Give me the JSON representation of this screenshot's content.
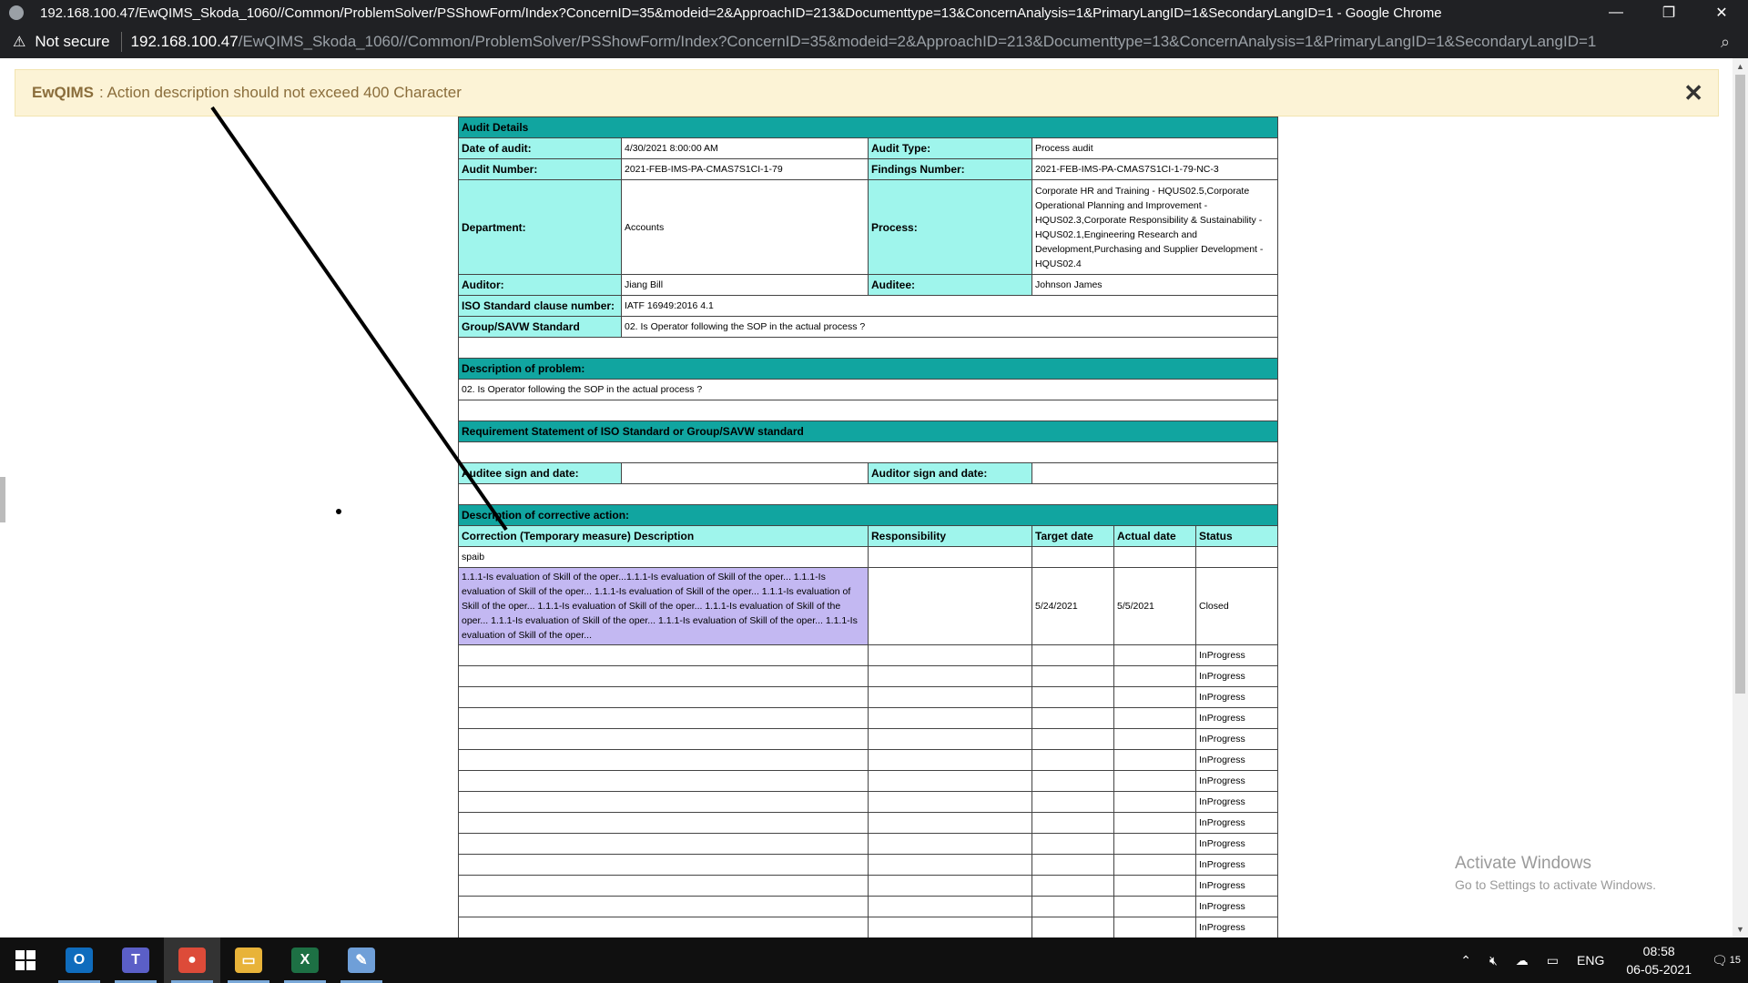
{
  "window": {
    "title": "192.168.100.47/EwQIMS_Skoda_1060//Common/ProblemSolver/PSShowForm/Index?ConcernID=35&modeid=2&ApproachID=213&Documenttype=13&ConcernAnalysis=1&PrimaryLangID=1&SecondaryLangID=1 - Google Chrome",
    "minimize": "—",
    "restore": "❐",
    "close": "✕"
  },
  "addressbar": {
    "not_secure": "Not secure",
    "host": "192.168.100.47",
    "path": "/EwQIMS_Skoda_1060//Common/ProblemSolver/PSShowForm/Index?ConcernID=35&modeid=2&ApproachID=213&Documenttype=13&ConcernAnalysis=1&PrimaryLangID=1&SecondaryLangID=1"
  },
  "alert": {
    "brand": "EwQIMS",
    "message": ": Action description should not exceed 400 Character",
    "close": "✕"
  },
  "form": {
    "audit_details": "Audit Details",
    "date_of_audit_label": "Date of audit:",
    "date_of_audit": "4/30/2021 8:00:00 AM",
    "audit_type_label": "Audit Type:",
    "audit_type": "Process audit",
    "audit_number_label": "Audit Number:",
    "audit_number": "2021-FEB-IMS-PA-CMAS7S1CI-1-79",
    "findings_number_label": "Findings Number:",
    "findings_number": "2021-FEB-IMS-PA-CMAS7S1CI-1-79-NC-3",
    "department_label": "Department:",
    "department": "Accounts",
    "process_label": "Process:",
    "process": "Corporate HR and Training - HQUS02.5,Corporate Operational Planning and Improvement - HQUS02.3,Corporate Responsibility & Sustainability - HQUS02.1,Engineering Research and Development,Purchasing and Supplier Development - HQUS02.4",
    "auditor_label": "Auditor:",
    "auditor": "Jiang Bill",
    "auditee_label": "Auditee:",
    "auditee": "Johnson James",
    "iso_label": "ISO Standard clause number:",
    "iso": "IATF 16949:2016 4.1",
    "group_label": "Group/SAVW Standard",
    "group": "02. Is Operator following the SOP in the actual process ?",
    "problem_header": "Description of problem:",
    "problem": "02. Is Operator following the SOP in the actual process ?",
    "requirement_header": "Requirement Statement of ISO Standard or Group/SAVW standard",
    "auditee_sign_label": "Auditee sign and date:",
    "auditor_sign_label": "Auditor sign and date:",
    "corrective_header": "Description of corrective action:",
    "col_correction": "Correction (Temporary measure) Description",
    "col_responsibility": "Responsibility",
    "col_target": "Target date",
    "col_actual": "Actual date",
    "col_status": "Status",
    "subrow": "spaib",
    "action_description": "1.1.1-Is evaluation of Skill of the oper...1.1.1-Is evaluation of Skill of the oper... 1.1.1-Is evaluation of Skill of the oper... 1.1.1-Is evaluation of Skill of the oper... 1.1.1-Is evaluation of Skill of the oper... 1.1.1-Is evaluation of Skill of the oper... 1.1.1-Is evaluation of Skill of the oper... 1.1.1-Is evaluation of Skill of the oper... 1.1.1-Is evaluation of Skill of the oper... 1.1.1-Is evaluation of Skill of the oper...",
    "action_target": "5/24/2021",
    "action_actual": "5/5/2021",
    "action_status": "Closed",
    "inprogress_rows": [
      "InProgress",
      "InProgress",
      "InProgress",
      "InProgress",
      "InProgress",
      "InProgress",
      "InProgress",
      "InProgress",
      "InProgress",
      "InProgress",
      "InProgress",
      "InProgress",
      "InProgress",
      "InProgress"
    ]
  },
  "watermark": {
    "line1": "Activate Windows",
    "line2": "Go to Settings to activate Windows."
  },
  "taskbar": {
    "apps": [
      {
        "name": "outlook-icon",
        "glyph": "O",
        "color": "#0f6cbd"
      },
      {
        "name": "teams-icon",
        "glyph": "T",
        "color": "#5b5fc7"
      },
      {
        "name": "chrome-icon",
        "glyph": "●",
        "color": "#dd4b39"
      },
      {
        "name": "file-explorer-icon",
        "glyph": "▭",
        "color": "#e8b339"
      },
      {
        "name": "excel-icon",
        "glyph": "X",
        "color": "#1d7044"
      },
      {
        "name": "paint-icon",
        "glyph": "✎",
        "color": "#6f9fd8"
      }
    ],
    "language": "ENG",
    "time": "08:58",
    "date": "06-05-2021",
    "notifications": "15"
  }
}
